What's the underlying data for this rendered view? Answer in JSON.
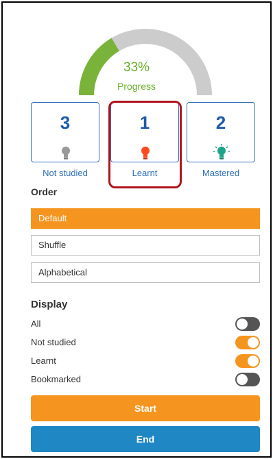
{
  "progress": {
    "percent_text": "33%",
    "label": "Progress",
    "value": 0.33,
    "fill_color": "#7ab33a",
    "track_color": "#cccccc"
  },
  "stats": [
    {
      "count": "3",
      "label": "Not studied",
      "icon": "lightbulb-icon",
      "icon_color": "#999999"
    },
    {
      "count": "1",
      "label": "Learnt",
      "icon": "lightbulb-icon",
      "icon_color": "#ff4b1f"
    },
    {
      "count": "2",
      "label": "Mastered",
      "icon": "lightbulb-glow-icon",
      "icon_color": "#1fa38a"
    }
  ],
  "order": {
    "title": "Order",
    "options": [
      "Default",
      "Shuffle",
      "Alphabetical"
    ],
    "selected": "Default"
  },
  "display": {
    "title": "Display",
    "items": [
      {
        "label": "All",
        "on": false
      },
      {
        "label": "Not studied",
        "on": true
      },
      {
        "label": "Learnt",
        "on": true
      },
      {
        "label": "Bookmarked",
        "on": false
      }
    ]
  },
  "actions": {
    "start_label": "Start",
    "end_label": "End"
  },
  "colors": {
    "accent_orange": "#f5951f",
    "accent_blue": "#1f87c4",
    "brand_blue": "#2f6fb8",
    "highlight_red": "#b0141c"
  }
}
